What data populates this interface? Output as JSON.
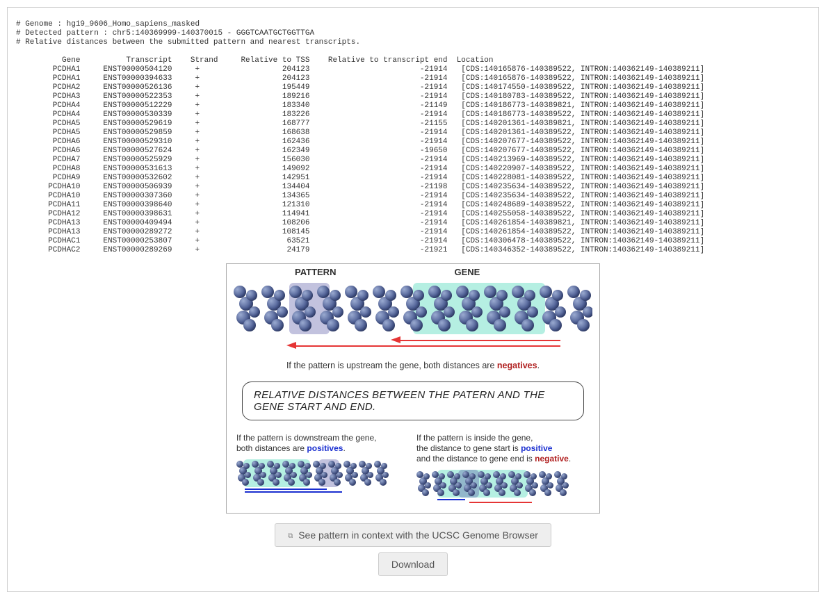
{
  "header": {
    "genome_line": "# Genome : hg19_9606_Homo_sapiens_masked",
    "pattern_line": "# Detected pattern : chr5:140369999-140370015 - GGGTCAATGCTGGTTGA",
    "distances_line": "# Relative distances between the submitted pattern and nearest transcripts."
  },
  "columns": [
    "Gene",
    "Transcript",
    "Strand",
    "Relative to TSS",
    "Relative to transcript end",
    "Location"
  ],
  "rows": [
    {
      "gene": "PCDHA1",
      "tr": "ENST00000504120",
      "strand": "+",
      "tss": "204123",
      "end": "-21914",
      "loc": "[CDS:140165876-140389522, INTRON:140362149-140389211]"
    },
    {
      "gene": "PCDHA1",
      "tr": "ENST00000394633",
      "strand": "+",
      "tss": "204123",
      "end": "-21914",
      "loc": "[CDS:140165876-140389522, INTRON:140362149-140389211]"
    },
    {
      "gene": "PCDHA2",
      "tr": "ENST00000526136",
      "strand": "+",
      "tss": "195449",
      "end": "-21914",
      "loc": "[CDS:140174550-140389522, INTRON:140362149-140389211]"
    },
    {
      "gene": "PCDHA3",
      "tr": "ENST00000522353",
      "strand": "+",
      "tss": "189216",
      "end": "-21914",
      "loc": "[CDS:140180783-140389522, INTRON:140362149-140389211]"
    },
    {
      "gene": "PCDHA4",
      "tr": "ENST00000512229",
      "strand": "+",
      "tss": "183340",
      "end": "-21149",
      "loc": "[CDS:140186773-140389821, INTRON:140362149-140389211]"
    },
    {
      "gene": "PCDHA4",
      "tr": "ENST00000530339",
      "strand": "+",
      "tss": "183226",
      "end": "-21914",
      "loc": "[CDS:140186773-140389522, INTRON:140362149-140389211]"
    },
    {
      "gene": "PCDHA5",
      "tr": "ENST00000529619",
      "strand": "+",
      "tss": "168777",
      "end": "-21155",
      "loc": "[CDS:140201361-140389821, INTRON:140362149-140389211]"
    },
    {
      "gene": "PCDHA5",
      "tr": "ENST00000529859",
      "strand": "+",
      "tss": "168638",
      "end": "-21914",
      "loc": "[CDS:140201361-140389522, INTRON:140362149-140389211]"
    },
    {
      "gene": "PCDHA6",
      "tr": "ENST00000529310",
      "strand": "+",
      "tss": "162436",
      "end": "-21914",
      "loc": "[CDS:140207677-140389522, INTRON:140362149-140389211]"
    },
    {
      "gene": "PCDHA6",
      "tr": "ENST00000527624",
      "strand": "+",
      "tss": "162349",
      "end": "-19650",
      "loc": "[CDS:140207677-140389522, INTRON:140362149-140389211]"
    },
    {
      "gene": "PCDHA7",
      "tr": "ENST00000525929",
      "strand": "+",
      "tss": "156030",
      "end": "-21914",
      "loc": "[CDS:140213969-140389522, INTRON:140362149-140389211]"
    },
    {
      "gene": "PCDHA8",
      "tr": "ENST00000531613",
      "strand": "+",
      "tss": "149092",
      "end": "-21914",
      "loc": "[CDS:140220907-140389522, INTRON:140362149-140389211]"
    },
    {
      "gene": "PCDHA9",
      "tr": "ENST00000532602",
      "strand": "+",
      "tss": "142951",
      "end": "-21914",
      "loc": "[CDS:140228081-140389522, INTRON:140362149-140389211]"
    },
    {
      "gene": "PCDHA10",
      "tr": "ENST00000506939",
      "strand": "+",
      "tss": "134404",
      "end": "-21198",
      "loc": "[CDS:140235634-140389522, INTRON:140362149-140389211]"
    },
    {
      "gene": "PCDHA10",
      "tr": "ENST00000307360",
      "strand": "+",
      "tss": "134365",
      "end": "-21914",
      "loc": "[CDS:140235634-140389522, INTRON:140362149-140389211]"
    },
    {
      "gene": "PCDHA11",
      "tr": "ENST00000398640",
      "strand": "+",
      "tss": "121310",
      "end": "-21914",
      "loc": "[CDS:140248689-140389522, INTRON:140362149-140389211]"
    },
    {
      "gene": "PCDHA12",
      "tr": "ENST00000398631",
      "strand": "+",
      "tss": "114941",
      "end": "-21914",
      "loc": "[CDS:140255058-140389522, INTRON:140362149-140389211]"
    },
    {
      "gene": "PCDHA13",
      "tr": "ENST00000409494",
      "strand": "+",
      "tss": "108206",
      "end": "-21914",
      "loc": "[CDS:140261854-140389821, INTRON:140362149-140389211]"
    },
    {
      "gene": "PCDHA13",
      "tr": "ENST00000289272",
      "strand": "+",
      "tss": "108145",
      "end": "-21914",
      "loc": "[CDS:140261854-140389522, INTRON:140362149-140389211]"
    },
    {
      "gene": "PCDHAC1",
      "tr": "ENST00000253807",
      "strand": "+",
      "tss": "63521",
      "end": "-21914",
      "loc": "[CDS:140306478-140389522, INTRON:140362149-140389211]"
    },
    {
      "gene": "PCDHAC2",
      "tr": "ENST00000289269",
      "strand": "+",
      "tss": "24179",
      "end": "-21921",
      "loc": "[CDS:140346352-140389522, INTRON:140362149-140389211]"
    }
  ],
  "figure": {
    "label_pattern": "PATTERN",
    "label_gene": "GENE",
    "caption_upstream_a": "If the pattern is upstream the gene, both distances are ",
    "caption_upstream_b": "negatives",
    "caption_upstream_c": ".",
    "bubble": "RELATIVE DISTANCES BETWEEN THE PATERN AND THE GENE START AND END.",
    "downstream_a": "If the pattern is downstream the gene,",
    "downstream_b": "both distances are ",
    "positives": "positives",
    "period": ".",
    "inside_a": "If the pattern is inside the gene,",
    "inside_b": "the distance to gene start is ",
    "positive": "positive",
    "inside_c": "and the distance to gene end is ",
    "negative": "negative"
  },
  "buttons": {
    "ucsc": "See pattern in context with the UCSC Genome Browser",
    "download": "Download"
  }
}
